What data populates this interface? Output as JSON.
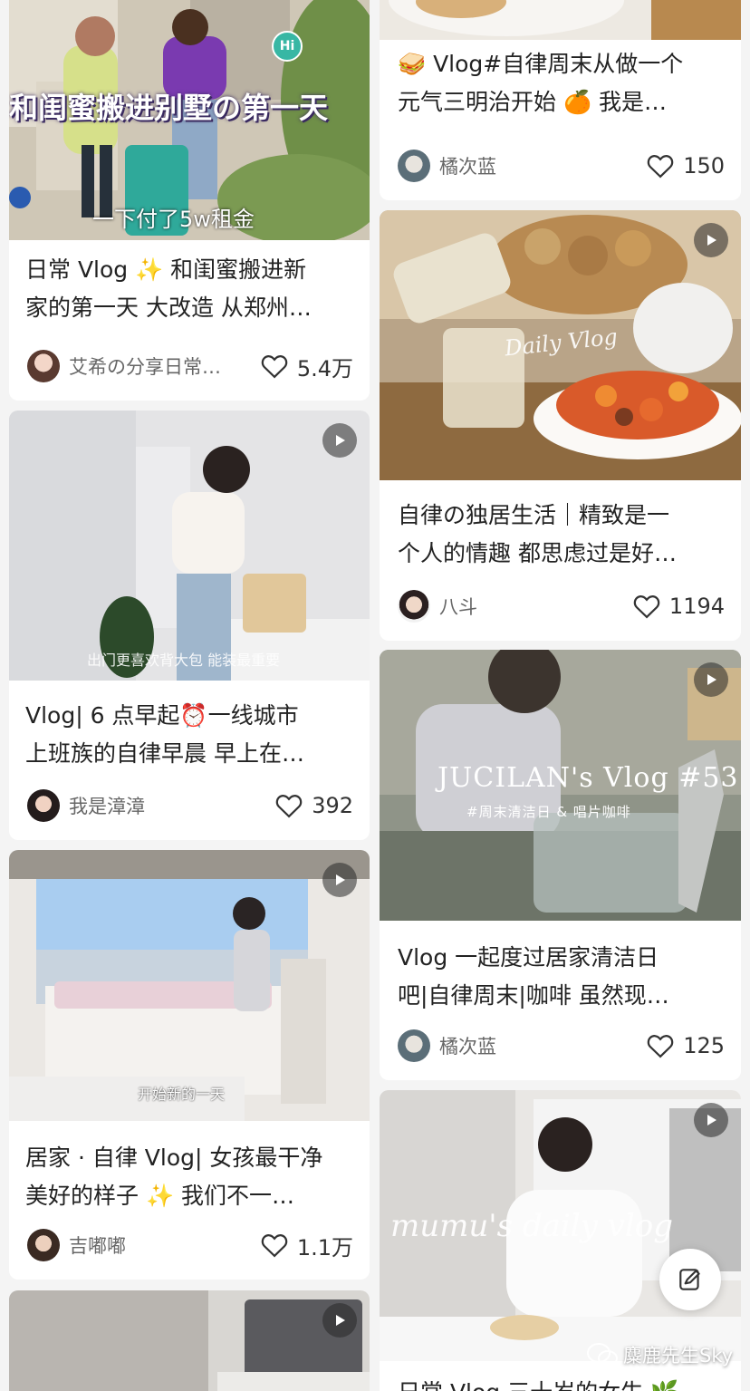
{
  "feed": {
    "cards": [
      {
        "title_line1": "日常 Vlog ✨ 和闺蜜搬进新",
        "title_line2": "家的第一天 大改造 从郑州…",
        "author": "艾希の分享日常…",
        "likes": "5.4万",
        "overlay_main": "和闺蜜搬进别墅の第一天",
        "overlay_sub": "一下付了5w租金",
        "overlay_badge": "Hi"
      },
      {
        "title_line1": "Vlog| 6 点早起⏰一线城市",
        "title_line2": "上班族的自律早晨 早上在…",
        "author": "我是漳漳",
        "likes": "392",
        "overlay_caption": "出门更喜欢背大包 能装最重要"
      },
      {
        "title_line1": "居家 · 自律 Vlog| 女孩最干净",
        "title_line2": "美好的样子 ✨ 我们不一…",
        "author": "吉嘟嘟",
        "likes": "1.1万",
        "overlay_caption": "开始新的一天"
      },
      {
        "title_line1": "🥪 Vlog#自律周末从做一个",
        "title_line2": "元气三明治开始 🍊 我是…",
        "author": "橘次蓝",
        "likes": "150"
      },
      {
        "title_line1": "自律の独居生活｜精致是一",
        "title_line2": "个人的情趣 都思虑过是好…",
        "author": "八斗",
        "likes": "1194",
        "overlay_script": "Daily Vlog"
      },
      {
        "title_line1": "Vlog 一起度过居家清洁日",
        "title_line2": "吧|自律周末|咖啡 虽然现…",
        "author": "橘次蓝",
        "likes": "125",
        "overlay_title": "JUCILAN's Vlog #53",
        "overlay_sub": "#周末清洁日 & 唱片咖啡"
      },
      {
        "title_line1": "日常 Vlog 三十岁的女生 🌿",
        "overlay_script": "mumu's daily vlog"
      }
    ]
  },
  "watermark": {
    "text": "麋鹿先生Sky"
  },
  "icons": {
    "play": "play-icon",
    "heart": "heart-icon",
    "compose": "compose-icon"
  },
  "colors": {
    "background": "#f4f4f4",
    "card": "#ffffff",
    "text": "#222222",
    "muted": "#666666"
  }
}
